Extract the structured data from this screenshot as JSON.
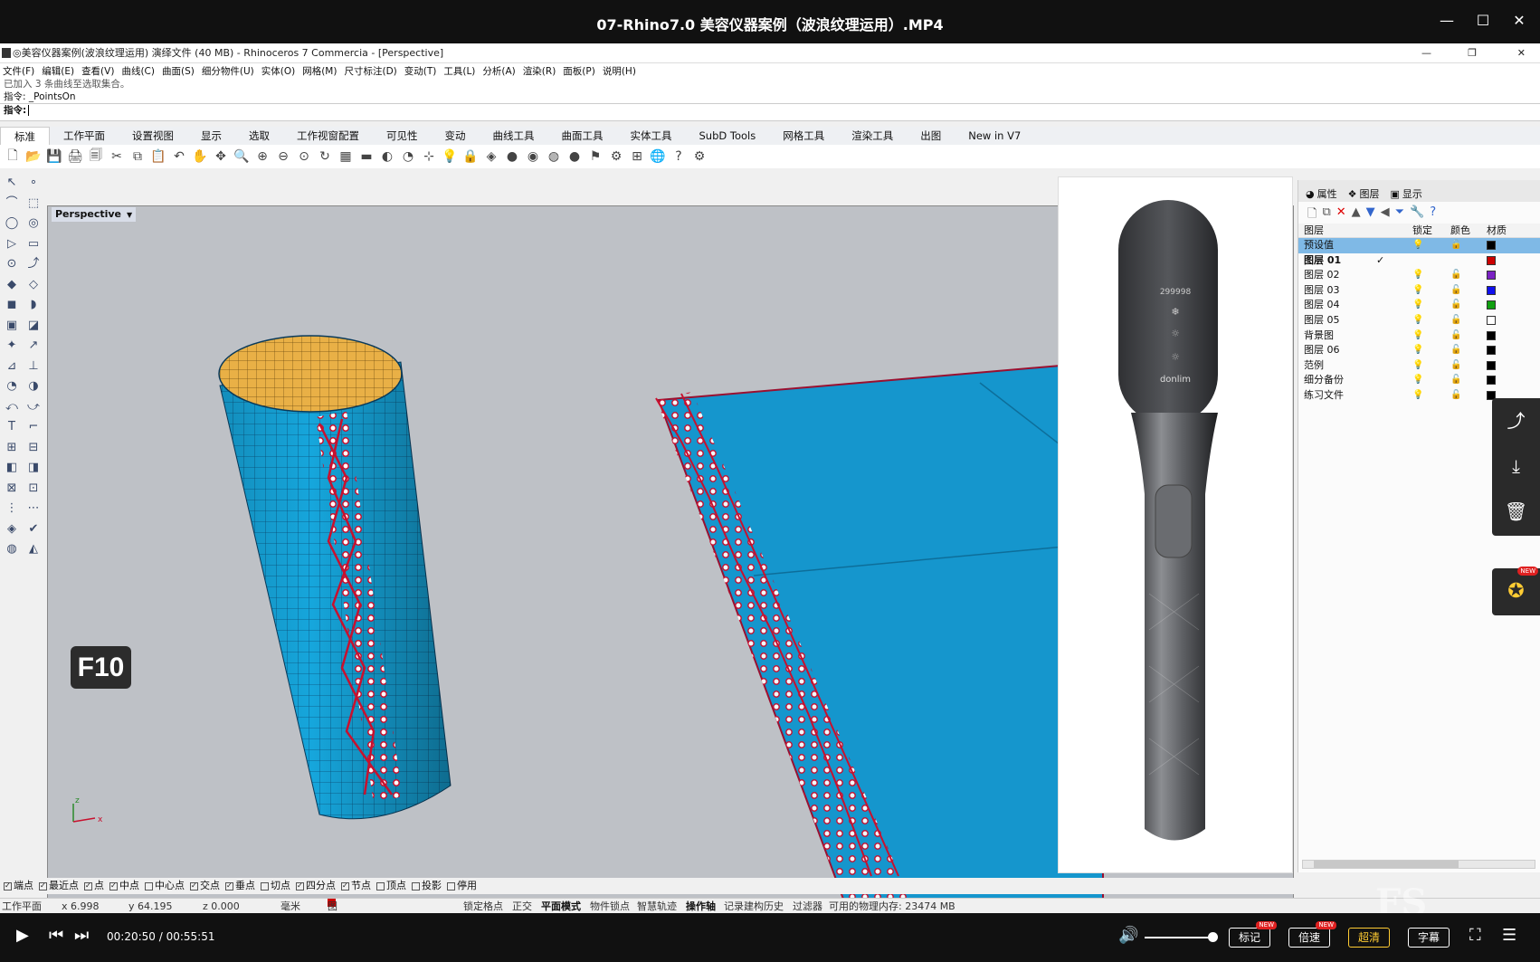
{
  "player": {
    "title": "07-Rhino7.0 美容仪器案例（波浪纹理运用）.MP4",
    "time": "00:20:50 / 00:55:51",
    "buttons": {
      "mark": "标记",
      "speed": "倍速",
      "quality": "超清",
      "subtitle": "字幕"
    },
    "new_tag": "NEW",
    "controls": {
      "play": "▶",
      "prev": "⏮",
      "next": "⏭",
      "volume": "🔊",
      "fullscreen": "⛶",
      "list": "☰"
    },
    "watermark": "FS",
    "side_icons": {
      "share": "share-icon",
      "download": "download-icon",
      "delete": "trash-icon",
      "pin": "pin-icon"
    }
  },
  "app": {
    "title": "◎美容仪器案例(波浪纹理运用) 演绎文件 (40 MB) - Rhinoceros 7 Commercia - [Perspective]",
    "menu": [
      "文件(F)",
      "编辑(E)",
      "查看(V)",
      "曲线(C)",
      "曲面(S)",
      "细分物件(U)",
      "实体(O)",
      "网格(M)",
      "尺寸标注(D)",
      "变动(T)",
      "工具(L)",
      "分析(A)",
      "渲染(R)",
      "面板(P)",
      "说明(H)"
    ],
    "command_history": [
      "已加入 3 条曲线至选取集合。",
      "指令: _PointsOn"
    ],
    "command_prompt": "指令:",
    "tabs": [
      "标准",
      "工作平面",
      "设置视图",
      "显示",
      "选取",
      "工作视窗配置",
      "可见性",
      "变动",
      "曲线工具",
      "曲面工具",
      "实体工具",
      "SubD Tools",
      "网格工具",
      "渲染工具",
      "出图",
      "New in V7"
    ],
    "active_tab": "标准",
    "viewport_label": "Perspective",
    "key_overlay": "F10",
    "axis_x": "x",
    "axis_z": "z",
    "device_display": [
      "299998",
      "❄",
      "☼",
      "☼",
      "donlim"
    ]
  },
  "panel": {
    "tabs": [
      "属性",
      "图层",
      "显示"
    ],
    "headers": [
      "图层",
      "",
      "锁定",
      "颜色",
      "材质"
    ],
    "layers": [
      {
        "name": "预设值",
        "color": "#000000",
        "selected": true
      },
      {
        "name": "图层 01",
        "color": "#cc0000",
        "current": true
      },
      {
        "name": "图层 02",
        "color": "#7b22c4"
      },
      {
        "name": "图层 03",
        "color": "#1010ee"
      },
      {
        "name": "图层 04",
        "color": "#10a010"
      },
      {
        "name": "图层 05",
        "color": "#ffffff"
      },
      {
        "name": "背景图",
        "color": "#000000"
      },
      {
        "name": "图层 06",
        "color": "#000000"
      },
      {
        "name": "范例",
        "color": "#000000"
      },
      {
        "name": "细分备份",
        "color": "#000000"
      },
      {
        "name": "练习文件",
        "color": "#000000"
      }
    ],
    "check_mark": "✓"
  },
  "snaps": [
    {
      "label": "端点",
      "on": true
    },
    {
      "label": "最近点",
      "on": true
    },
    {
      "label": "点",
      "on": true
    },
    {
      "label": "中点",
      "on": true
    },
    {
      "label": "中心点",
      "on": false
    },
    {
      "label": "交点",
      "on": true
    },
    {
      "label": "垂点",
      "on": true
    },
    {
      "label": "切点",
      "on": false
    },
    {
      "label": "四分点",
      "on": true
    },
    {
      "label": "节点",
      "on": true
    },
    {
      "label": "顶点",
      "on": false
    },
    {
      "label": "投影",
      "on": false
    },
    {
      "label": "停用",
      "on": false
    }
  ],
  "status": {
    "plane": "工作平面",
    "x": "x 6.998",
    "y": "y 64.195",
    "z": "z 0.000",
    "unit": "毫米",
    "layer": "图层 01",
    "grid_snap": "锁定格点",
    "ortho": "正交",
    "planar": "平面模式",
    "osnap": "物件锁点",
    "smart": "智慧轨迹",
    "gumball": "操作轴",
    "history": "记录建构历史",
    "filter": "过滤器",
    "memory": "可用的物理内存: 23474 MB"
  },
  "colors": {
    "accent": "#0fa0d8",
    "curve": "#c8102e",
    "surface_inner": "#e8b040"
  }
}
